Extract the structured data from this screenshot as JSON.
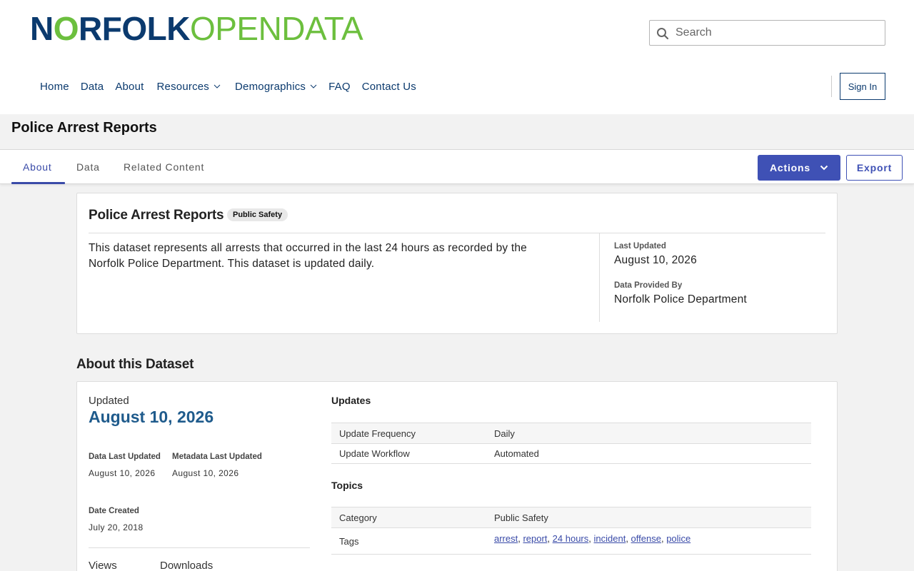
{
  "site": {
    "logo_part1": "N",
    "logo_o": "O",
    "logo_part2": "RFOLK",
    "logo_part3": "OPENDATA",
    "search_placeholder": "Search"
  },
  "nav": {
    "items": [
      {
        "label": "Home"
      },
      {
        "label": "Data"
      },
      {
        "label": "About"
      },
      {
        "label": "Resources",
        "has_menu": true
      },
      {
        "label": "Demographics",
        "has_menu": true
      },
      {
        "label": "FAQ"
      },
      {
        "label": "Contact Us"
      }
    ],
    "sign_in": "Sign In"
  },
  "page": {
    "title": "Police Arrest Reports"
  },
  "tabs": {
    "items": [
      {
        "label": "About",
        "active": true
      },
      {
        "label": "Data"
      },
      {
        "label": "Related Content"
      }
    ],
    "actions_label": "Actions",
    "export_label": "Export"
  },
  "summary": {
    "title": "Police Arrest Reports",
    "badge": "Public Safety",
    "description": "This dataset represents all arrests that occurred in the last 24 hours as recorded by the Norfolk Police Department. This dataset is updated daily.",
    "last_updated_label": "Last Updated",
    "last_updated_value": "August 10, 2026",
    "provided_by_label": "Data Provided By",
    "provided_by_value": "Norfolk Police Department"
  },
  "about": {
    "heading": "About this Dataset",
    "updated_label": "Updated",
    "updated_value": "August 10, 2026",
    "data_last_updated_label": "Data Last Updated",
    "data_last_updated_value": "August 10, 2026",
    "metadata_last_updated_label": "Metadata Last Updated",
    "metadata_last_updated_value": "August 10, 2026",
    "date_created_label": "Date Created",
    "date_created_value": "July 20, 2018",
    "views_label": "Views",
    "downloads_label": "Downloads",
    "updates_heading": "Updates",
    "updates": [
      {
        "key": "Update Frequency",
        "value": "Daily"
      },
      {
        "key": "Update Workflow",
        "value": "Automated"
      }
    ],
    "topics_heading": "Topics",
    "category_key": "Category",
    "category_value": "Public Safety",
    "tags_key": "Tags",
    "tags": [
      "arrest",
      "report",
      "24 hours",
      "incident",
      "offense",
      "police"
    ]
  },
  "colors": {
    "brand_navy": "#0b3a6e",
    "brand_green": "#6cbf3e",
    "accent": "#3f51b5",
    "date_blue": "#1f5b8c"
  }
}
